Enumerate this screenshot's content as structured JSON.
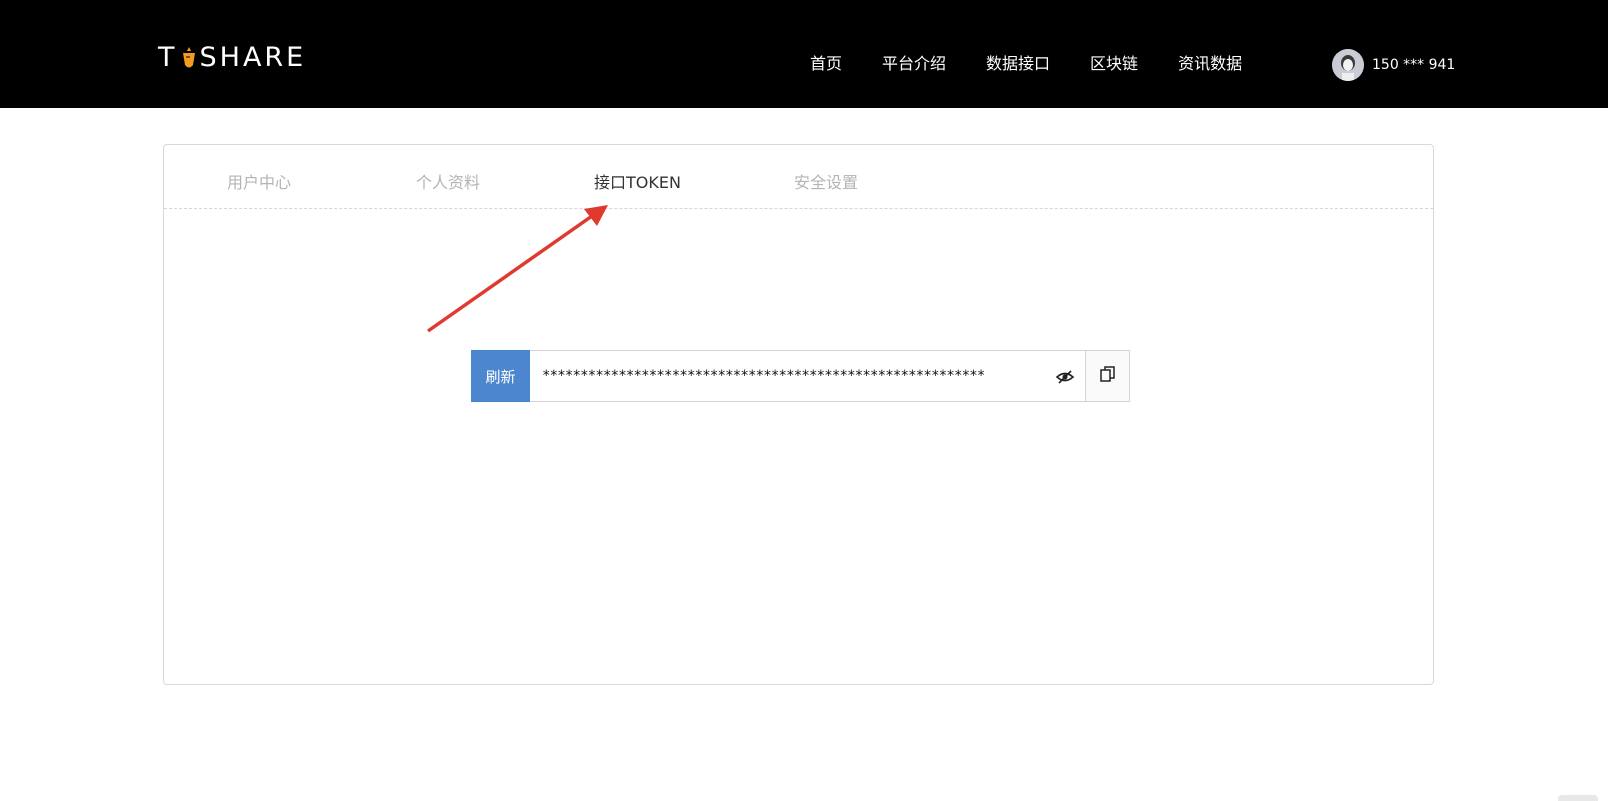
{
  "header": {
    "logo_text_left": "T",
    "logo_text_right": "SHARE",
    "nav": [
      {
        "label": "首页"
      },
      {
        "label": "平台介绍"
      },
      {
        "label": "数据接口"
      },
      {
        "label": "区块链"
      },
      {
        "label": "资讯数据"
      }
    ],
    "user_label": "150 *** 941"
  },
  "tabs": [
    {
      "label": "用户中心"
    },
    {
      "label": "个人资料"
    },
    {
      "label": "接口TOKEN"
    },
    {
      "label": "安全设置"
    }
  ],
  "active_tab": "接口TOKEN",
  "token": {
    "refresh_label": "刷新",
    "masked_value": "**********************************************************",
    "toggle_icon": "eye-slash-icon",
    "copy_icon": "copy-icon"
  },
  "colors": {
    "header_bg": "#000000",
    "accent": "#4b86cf",
    "arrow": "#e03a2f",
    "logo_carrot": "#f39c1f"
  }
}
